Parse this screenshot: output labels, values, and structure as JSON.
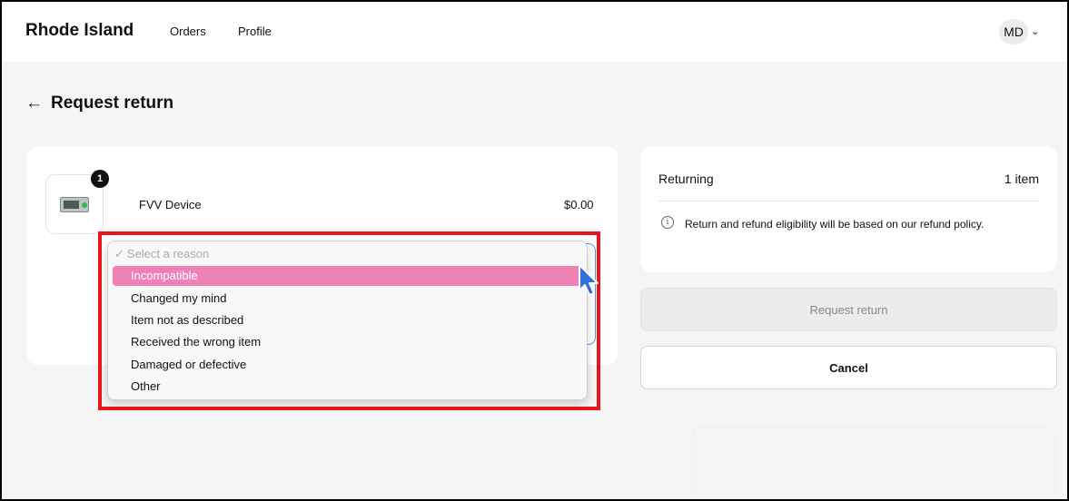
{
  "header": {
    "brand": "Rhode Island",
    "nav": [
      "Orders",
      "Profile"
    ],
    "avatar_initials": "MD",
    "avatar_menu_icon": "chevron-down-icon"
  },
  "page": {
    "back_icon": "arrow-left-icon",
    "title": "Request return"
  },
  "item": {
    "quantity": "1",
    "name": "FVV Device",
    "price": "$0.00"
  },
  "reason_dropdown": {
    "placeholder": "Select a reason",
    "highlighted": "Incompatible",
    "options": [
      "Changed my mind",
      "Item not as described",
      "Received the wrong item",
      "Damaged or defective",
      "Other"
    ]
  },
  "summary": {
    "label": "Returning",
    "count": "1 item",
    "note": "Return and refund eligibility will be based on our refund policy."
  },
  "actions": {
    "request_label": "Request return",
    "cancel_label": "Cancel"
  },
  "colors": {
    "highlight_option": "#ee82b5",
    "annotation_box": "#e8141c",
    "select_focus": "#5b8def"
  }
}
